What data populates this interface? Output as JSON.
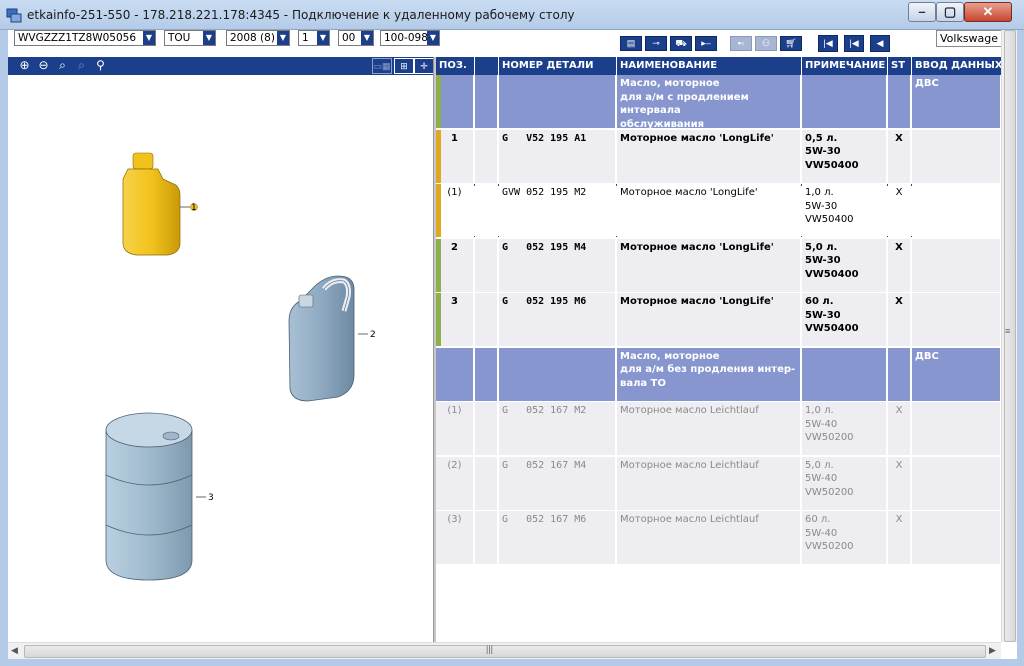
{
  "window": {
    "title": "etkainfo-251-550 - 178.218.221.178:4345 - Подключение к удаленному рабочему столу"
  },
  "selectors": {
    "vin": "WVGZZZ1TZ8W05056",
    "model": "TOU",
    "year": "2008 (8)",
    "field1": "1",
    "field2": "00",
    "field3": "100-098",
    "brand": "Volkswage"
  },
  "toolbar_icons": [
    "list-icon",
    "key-icon",
    "car-icon",
    "play-icon",
    "catalog-icon",
    "user-icon",
    "cart-icon"
  ],
  "nav_icons": [
    "first-page-icon",
    "previous-page-icon",
    "back-icon"
  ],
  "callouts": [
    "1",
    "2",
    "3"
  ],
  "table": {
    "headers": {
      "pos": "ПОЗ.",
      "part_number": "НОМЕР ДЕТАЛИ",
      "name": "НАИМЕНОВАНИЕ",
      "note": "ПРИМЕЧАНИЕ",
      "st": "ST",
      "input": "ВВОД ДАННЫХ"
    },
    "rows": [
      {
        "type": "group",
        "pos": "",
        "part_number": "",
        "name": "Масло, моторное\nдля а/м с продлением интервала\nобслуживания",
        "note": "",
        "st": "",
        "input": "ДВС",
        "marker": "#8db04c"
      },
      {
        "type": "part",
        "pos": "1",
        "part_number": "G   V52 195 A1",
        "name": "Моторное масло 'LongLife'",
        "note": "0,5 л.\n5W-30\nVW50400",
        "st": "X",
        "input": "",
        "marker": "#e0a81e"
      },
      {
        "type": "sel-row",
        "pos": "(1)",
        "part_number": "GVW 052 195 M2",
        "name": "Моторное масло 'LongLife'",
        "note": "1,0 л.\n5W-30\nVW50400",
        "st": "X",
        "input": "",
        "marker": "#e0a81e"
      },
      {
        "type": "part",
        "pos": "2",
        "part_number": "G   052 195 M4",
        "name": "Моторное масло 'LongLife'",
        "note": "5,0 л.\n5W-30\nVW50400",
        "st": "X",
        "input": "",
        "marker": "#8db04c"
      },
      {
        "type": "part",
        "pos": "3",
        "part_number": "G   052 195 M6",
        "name": "Моторное масло 'LongLife'",
        "note": "60 л.\n5W-30\nVW50400",
        "st": "X",
        "input": "",
        "marker": "#8db04c"
      },
      {
        "type": "group",
        "pos": "",
        "part_number": "",
        "name": "Масло, моторное\nдля а/м без продления интер-\nвала ТО",
        "note": "",
        "st": "",
        "input": "ДВС",
        "marker": ""
      },
      {
        "type": "dimmed",
        "pos": "(1)",
        "part_number": "G   052 167 M2",
        "name": "Моторное масло Leichtlauf",
        "note": "1,0 л.\n5W-40\nVW50200",
        "st": "X",
        "input": "",
        "marker": ""
      },
      {
        "type": "dimmed",
        "pos": "(2)",
        "part_number": "G   052 167 M4",
        "name": "Моторное масло Leichtlauf",
        "note": "5,0 л.\n5W-40\nVW50200",
        "st": "X",
        "input": "",
        "marker": ""
      },
      {
        "type": "dimmed",
        "pos": "(3)",
        "part_number": "G   052 167 M6",
        "name": "Моторное масло Leichtlauf",
        "note": "60 л.\n5W-40\nVW50200",
        "st": "X",
        "input": "",
        "marker": ""
      }
    ]
  },
  "colors": {
    "header_blue": "#1c3f8c",
    "group_row": "#8796cf",
    "part_row": "#eeeef2",
    "marker_orange": "#e0a81e",
    "marker_green": "#8db04c"
  }
}
